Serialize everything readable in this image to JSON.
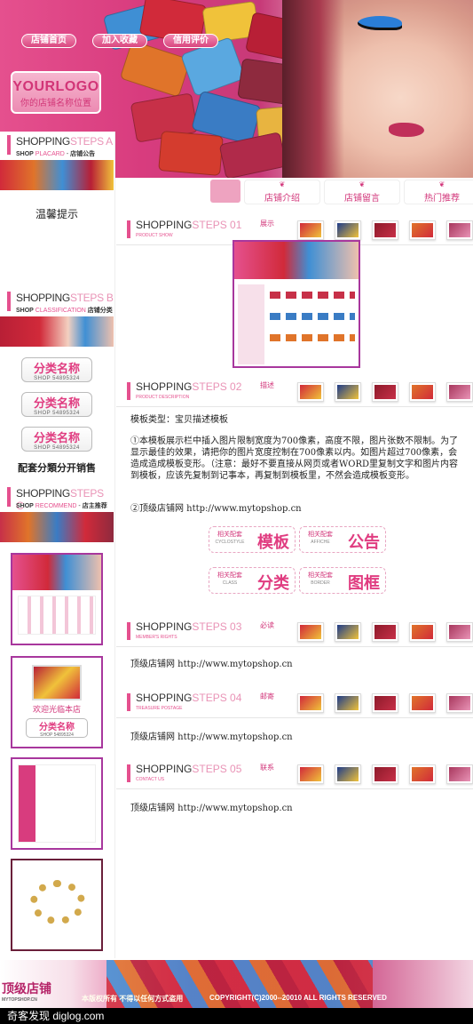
{
  "header": {
    "nav": [
      "店铺首页",
      "加入收藏",
      "信用评价"
    ],
    "logo_title": "YOURLOGO",
    "logo_subtitle": "你的店铺名称位置"
  },
  "tabs": {
    "hot": "",
    "items": [
      "店铺介绍",
      "店铺留言",
      "热门推荐"
    ]
  },
  "sidebar": {
    "step_a": {
      "big": "SHOPPING",
      "big2": "STEPS A",
      "sub": "SHOP",
      "sub2": "PLACARD",
      "cn": "店铺公告"
    },
    "warm_tip": "温馨提示",
    "step_b": {
      "big": "SHOPPING",
      "big2": "STEPS B",
      "sub": "SHOP",
      "sub2": "CLASSIFICATION",
      "cn": "店铺分类"
    },
    "categories": [
      {
        "name": "分类名称",
        "code": "SHOP 54895324"
      },
      {
        "name": "分类名称",
        "code": "SHOP 54895324"
      },
      {
        "name": "分类名称",
        "code": "SHOP 54895324"
      }
    ],
    "category_sell": "配套分類分开销售",
    "step_c": {
      "big": "SHOPPING",
      "big2": "STEPS C",
      "sub": "SHOP",
      "sub2": "RECOMMEND",
      "cn": "店主推荐"
    },
    "welcome_text": "欢迎光临本店",
    "thumb_cat": {
      "name": "分类名称",
      "code": "SHOP 54895324"
    }
  },
  "sections": [
    {
      "big": "SHOPPING",
      "big2": "STEPS 01",
      "sub": "PRODUCT",
      "sub2": "SHOW",
      "label": "展示"
    },
    {
      "big": "SHOPPING",
      "big2": "STEPS 02",
      "sub": "PRODUCT",
      "sub2": "DESCRIPTION",
      "label": "描述"
    },
    {
      "big": "SHOPPING",
      "big2": "STEPS 03",
      "sub": "MEMBER'S",
      "sub2": "RIGHTS",
      "label": "必读"
    },
    {
      "big": "SHOPPING",
      "big2": "STEPS 04",
      "sub": "TREASURE",
      "sub2": "POSTAGE",
      "label": "邮寄"
    },
    {
      "big": "SHOPPING",
      "big2": "STEPS 05",
      "sub": "CONTACT",
      "sub2": "US",
      "label": "联系"
    }
  ],
  "description": {
    "type_line": "模板类型：宝贝描述模板",
    "para1": "①本模板展示栏中插入图片限制宽度为700像素，高度不限，图片张数不限制。为了显示最佳的效果，请把你的图片宽度控制在700像素以内。如图片超过700像素，会造成造成模板变形。（注意：最好不要直接从网页或者WORD里复制文字和图片内容到模板，应该先复制到记事本，再复制到模板里，不然会造成模板变形。",
    "para2": "②顶级店铺网 http://www.mytopshop.cn"
  },
  "related": [
    {
      "k": "相关配套",
      "ks": "CYCLOSTYLE",
      "v": "模板"
    },
    {
      "k": "相关配套",
      "ks": "AFFICHE",
      "v": "公告"
    },
    {
      "k": "相关配套",
      "ks": "CLASS",
      "v": "分类"
    },
    {
      "k": "相关配套",
      "ks": "BORDER",
      "v": "图框"
    }
  ],
  "links": [
    "顶级店铺网 http://www.mytopshop.cn",
    "顶级店铺网 http://www.mytopshop.cn",
    "顶级店铺网 http://www.mytopshop.cn"
  ],
  "footer": {
    "logo": "顶级店铺",
    "logo_sub": "MYTOPSHOP.CN",
    "note": "本版权所有 不得以任何方式盗用",
    "copyright": "COPYRIGHT(C)2000--20010 ALL RIGHTS RESERVED"
  },
  "watermark": "奇客发现 diglog.com",
  "colors": {
    "accent": "#e5508e",
    "frame": "#a8379d"
  }
}
